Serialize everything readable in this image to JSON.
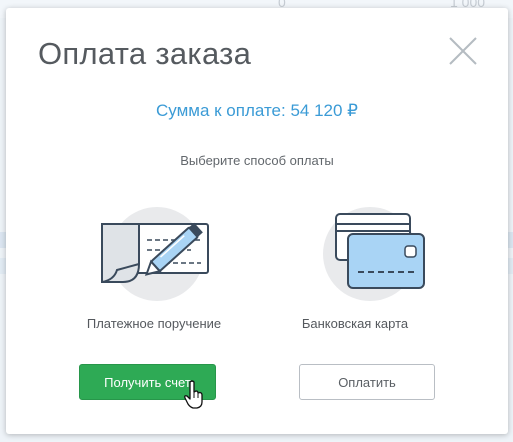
{
  "background": {
    "top_right_values": [
      "0",
      "1 000"
    ]
  },
  "modal": {
    "title": "Оплата заказа",
    "amount_text": "Сумма к оплате: 54 120 ₽",
    "subtitle": "Выберите способ оплаты",
    "methods": [
      {
        "label": "Платежное поручение",
        "icon": "payment-order-icon"
      },
      {
        "label": "Банковская карта",
        "icon": "bank-card-icon"
      }
    ],
    "buttons": {
      "primary_label": "Получить счет",
      "secondary_label": "Оплатить"
    }
  },
  "colors": {
    "accent_blue": "#3b9bd6",
    "primary_green": "#2eaa55",
    "title_gray": "#555a5f",
    "icon_stroke": "#3a4a5c",
    "card_blue": "#a9d4f5"
  }
}
